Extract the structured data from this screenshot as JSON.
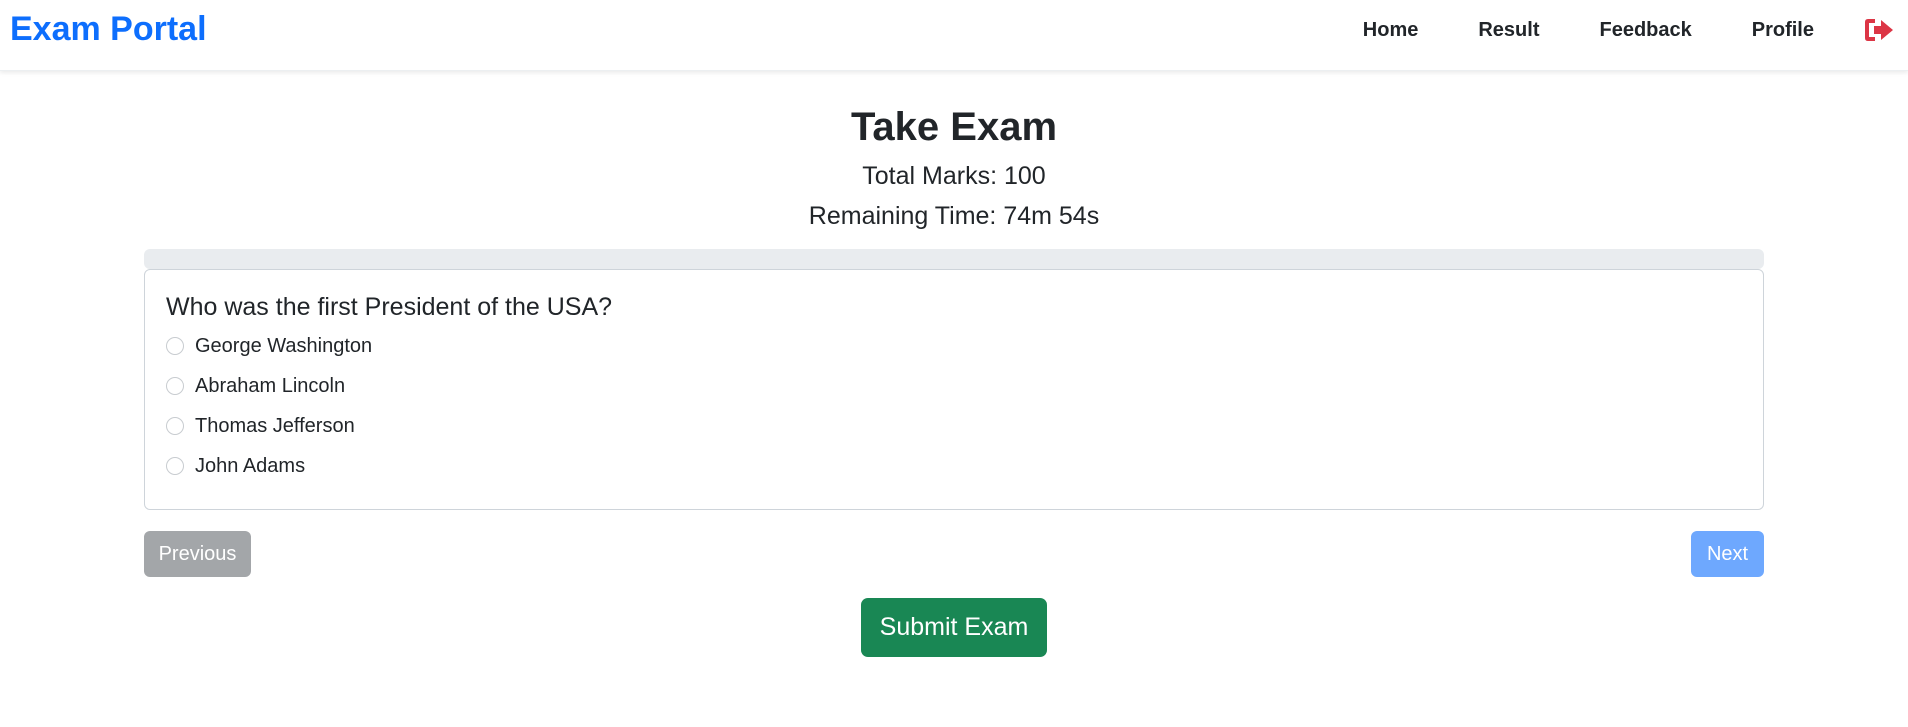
{
  "app": {
    "brand": "Exam Portal",
    "accent_color": "#0d6efd",
    "logout_icon": "logout-arrow-icon",
    "logout_color": "#dc3545"
  },
  "nav": {
    "items": [
      {
        "label": "Home"
      },
      {
        "label": "Result"
      },
      {
        "label": "Feedback"
      },
      {
        "label": "Profile"
      }
    ]
  },
  "exam": {
    "title": "Take Exam",
    "total_marks": "Total Marks: 100",
    "remaining_time": "Remaining Time: 74m 54s",
    "progress_percent": 0
  },
  "question": {
    "text": "Who was the first President of the USA?",
    "options": [
      {
        "label": "George Washington",
        "selected": false
      },
      {
        "label": "Abraham Lincoln",
        "selected": false
      },
      {
        "label": "Thomas Jefferson",
        "selected": false
      },
      {
        "label": "John Adams",
        "selected": false
      }
    ]
  },
  "buttons": {
    "previous": "Previous",
    "next": "Next",
    "submit": "Submit Exam"
  },
  "colors": {
    "previous_bg": "#a3a6a9",
    "next_bg": "#6ea8fe",
    "submit_bg": "#198754"
  }
}
